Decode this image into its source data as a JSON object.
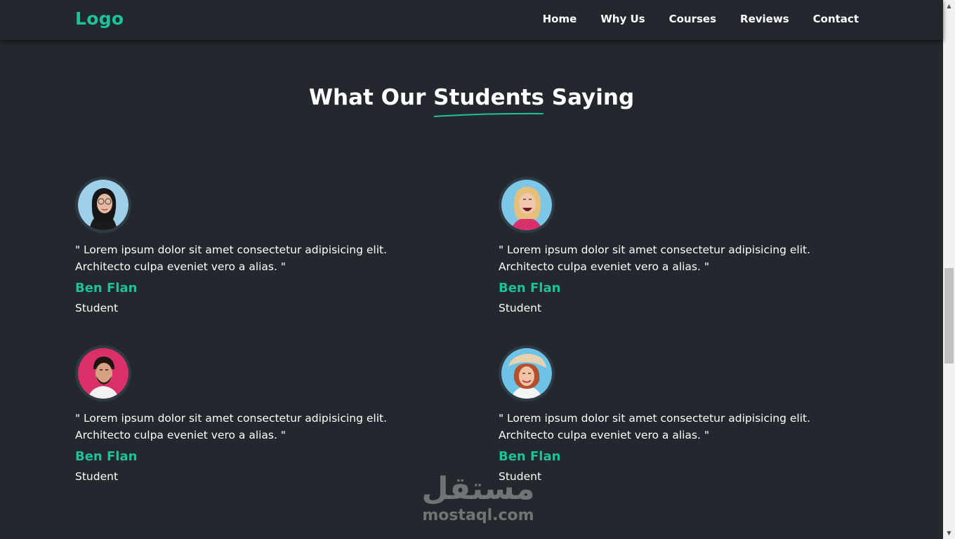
{
  "header": {
    "logo": "Logo",
    "nav": [
      "Home",
      "Why Us",
      "Courses",
      "Reviews",
      "Contact"
    ]
  },
  "section": {
    "title_before": "What Our",
    "title_highlight": "Students",
    "title_after": "Saying"
  },
  "testimonials": [
    {
      "quote": "\" Lorem ipsum dolor sit amet consectetur adipisicing elit. Architecto culpa eveniet vero a alias. \"",
      "name": "Ben Flan",
      "role": "Student",
      "avatar_icon": "student-avatar-woman-glasses"
    },
    {
      "quote": "\" Lorem ipsum dolor sit amet consectetur adipisicing elit. Architecto culpa eveniet vero a alias. \"",
      "name": "Ben Flan",
      "role": "Student",
      "avatar_icon": "student-avatar-woman-blonde"
    },
    {
      "quote": "\" Lorem ipsum dolor sit amet consectetur adipisicing elit. Architecto culpa eveniet vero a alias. \"",
      "name": "Ben Flan",
      "role": "Student",
      "avatar_icon": "student-avatar-man-beard"
    },
    {
      "quote": "\" Lorem ipsum dolor sit amet consectetur adipisicing elit. Architecto culpa eveniet vero a alias. \"",
      "name": "Ben Flan",
      "role": "Student",
      "avatar_icon": "student-avatar-woman-hat"
    }
  ],
  "watermark": {
    "arabic": "مستقل",
    "latin": "mostaql.com"
  },
  "colors": {
    "background": "#22282d",
    "accent": "#1ec19a",
    "text": "#ffffff"
  }
}
